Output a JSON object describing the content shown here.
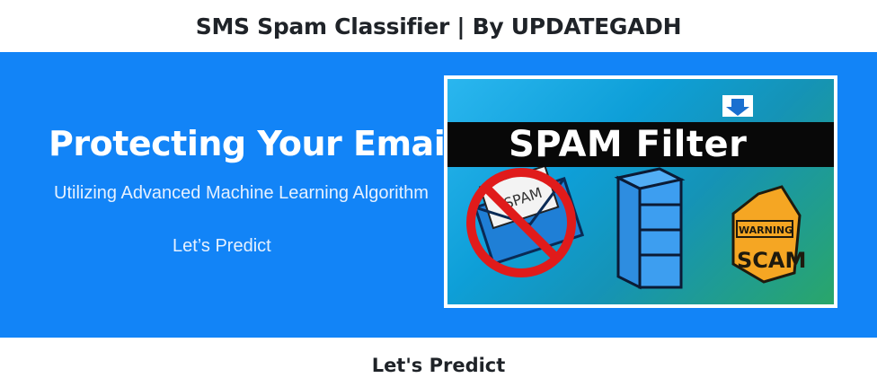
{
  "header": {
    "title": "SMS Spam Classifier | By UPDATEGADH"
  },
  "hero": {
    "title": "Protecting Your Emails",
    "subtitle": "Utilizing Advanced Machine Learning Algorithm",
    "cta_label": "Let’s Predict",
    "background_color": "#1284f7"
  },
  "banner": {
    "heading": "SPAM Filter",
    "envelope_text": "SPAM",
    "warning_sign_top": "WARNING",
    "warning_sign_bottom": "SCAM",
    "icons": [
      "download-arrow-icon",
      "no-spam-envelope-icon",
      "filing-cabinet-icon",
      "warning-scam-sign-icon"
    ]
  },
  "section": {
    "heading": "Let's Predict"
  }
}
